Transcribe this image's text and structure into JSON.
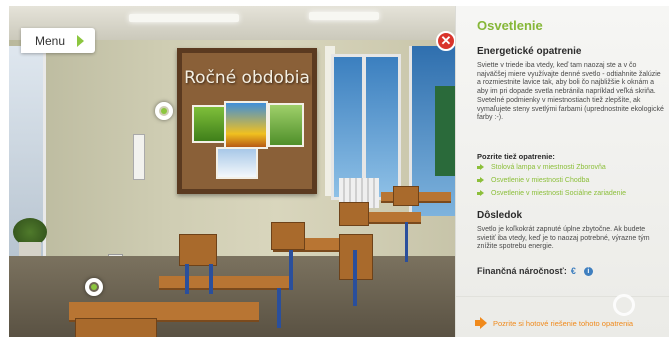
{
  "menu": {
    "label": "Menu"
  },
  "scene": {
    "board_title": "Ročné obdobia",
    "close_symbol": "✕"
  },
  "panel": {
    "title": "Osvetlenie",
    "measure_heading": "Energetické opatrenie",
    "measure_text": "Sviette v triede iba vtedy, keď tam naozaj ste a v čo najväčšej miere využívajte denné svetlo - odtiahnite žalúzie a rozmiestnite lavice tak, aby boli čo najbližšie k oknám a aby im pri dopade svetla nebránila napríklad veľká skriňa. Svetelné podmienky v miestnostiach tiež zlepšíte, ak vymaľujete steny svetlými farbami (uprednostnite ekologické farby :-).",
    "see_also_heading": "Pozrite tiež opatrenie:",
    "see_also_links": [
      "Stolová lampa v miestnosti Zborovňa",
      "Osvetlenie v miestnosti Chodba",
      "Osvetlenie v miestnosti Sociálne zariadenie"
    ],
    "consequence_heading": "Dôsledok",
    "consequence_text": "Svetlo je koľkokrát zapnuté úplne zbytočne. Ak budete svietiť iba vtedy, keď je to naozaj potrebné, výrazne tým znížite spotrebu energie.",
    "cost_label": "Finančná náročnosť:",
    "cost_value": "€",
    "info_symbol": "i",
    "cta_label": "Pozrite si hotové riešenie tohoto opatrenia"
  },
  "colors": {
    "accent_green": "#8cbf3a",
    "cta_orange": "#f08a1c",
    "close_red": "#d9342b",
    "info_blue": "#3f7fbf"
  },
  "icons": [
    "menu-arrow-icon",
    "close-icon",
    "hotspot-icon",
    "link-arrow-icon",
    "info-icon",
    "cta-arrow-icon"
  ]
}
